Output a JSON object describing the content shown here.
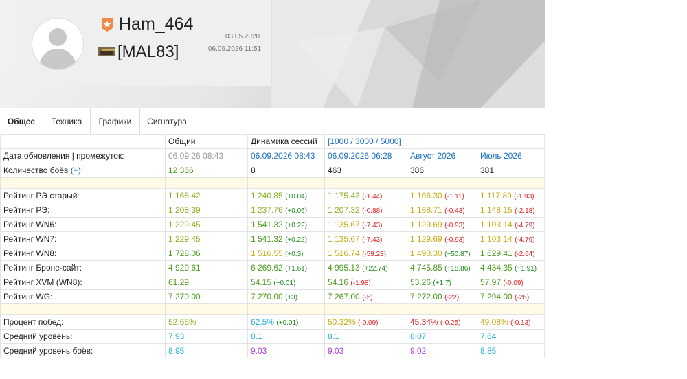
{
  "profile": {
    "nickname": "Ham_464",
    "clan": "[MAL83]",
    "registered": "03.05.2020",
    "updated": "06.09.2026 11:51"
  },
  "tabs": [
    "Общее",
    "Техника",
    "Графики",
    "Сигнатура"
  ],
  "table": {
    "headers": [
      "",
      "Общий",
      "Динамика сессий",
      "[1000 / 3000 / 5000]",
      "",
      ""
    ],
    "dates_row": {
      "label": "Дата обновления | промежуток:",
      "c1": "06.09.26 08:43",
      "c2": "06.09.2026 08:43",
      "c3": "06.09.2026 06:28",
      "c4": "Август 2026",
      "c5": "Июль 2026"
    },
    "battles_row": {
      "label": "Количество боёв",
      "plus": "(+)",
      "c1": "12 366",
      "c2": "8",
      "c3": "463",
      "c4": "386",
      "c5": "381",
      "colon": ":"
    },
    "ratings": [
      {
        "label": "Рейтинг РЭ старый:",
        "c1": "1 168.42",
        "c2": "1 240.85",
        "d2": "(+0.04)",
        "c3": "1 175.43",
        "d3": "(-1.44)",
        "c4": "1 106.30",
        "d4": "(-1.11)",
        "c5": "1 117.89",
        "d5": "(-1.93)"
      },
      {
        "label": "Рейтинг РЭ:",
        "c1": "1 208.39",
        "c2": "1 237.76",
        "d2": "(+0.06)",
        "c3": "1 207.32",
        "d3": "(-0.88)",
        "c4": "1 168.71",
        "d4": "(-0.43)",
        "c5": "1 148.15",
        "d5": "(-2.18)"
      },
      {
        "label": "Рейтинг WN6:",
        "c1": "1 229.45",
        "c2": "1 541.32",
        "d2": "(+0.22)",
        "c3": "1 135.67",
        "d3": "(-7.43)",
        "c4": "1 129.69",
        "d4": "(-0.93)",
        "c5": "1 103.14",
        "d5": "(-4.79)"
      },
      {
        "label": "Рейтинг WN7:",
        "c1": "1 229.45",
        "c2": "1 541.32",
        "d2": "(+0.22)",
        "c3": "1 135.67",
        "d3": "(-7.43)",
        "c4": "1 129.69",
        "d4": "(-0.93)",
        "c5": "1 103.14",
        "d5": "(-4.79)"
      },
      {
        "label": "Рейтинг WN8:",
        "c1": "1 728.06",
        "c2": "1 516.55",
        "d2": "(+0.3)",
        "c3": "1 516.74",
        "d3": "(-59.23)",
        "c4": "1 490.30",
        "d4": "(+50.87)",
        "c5": "1 629.41",
        "d5": "(-2.64)"
      },
      {
        "label": "Рейтинг Броне-сайт:",
        "c1": "4 929.61",
        "c2": "6 269.62",
        "d2": "(+1.61)",
        "c3": "4 995.13",
        "d3": "(+22.74)",
        "c4": "4 745.85",
        "d4": "(+18.86)",
        "c5": "4 434.35",
        "d5": "(+1.91)"
      },
      {
        "label": "Рейтинг XVM (WN8):",
        "c1": "61.29",
        "c2": "54.15",
        "d2": "(+0.01)",
        "c3": "54.16",
        "d3": "(-1.98)",
        "c4": "53.26",
        "d4": "(+1.7)",
        "c5": "57.97",
        "d5": "(-0.09)"
      },
      {
        "label": "Рейтинг WG:",
        "c1": "7 270.00",
        "c2": "7 270.00",
        "d2": "(+3)",
        "c3": "7 267.00",
        "d3": "(-5)",
        "c4": "7 272.00",
        "d4": "(-22)",
        "c5": "7 294.00",
        "d5": "(-26)"
      }
    ],
    "other": [
      {
        "label": "Процент побед:",
        "c1": "52.65%",
        "c2": "62.5%",
        "d2": "(+0.01)",
        "c3": "50.32%",
        "d3": "(-0.09)",
        "c4": "45.34%",
        "d4": "(-0.25)",
        "c5": "49.08%",
        "d5": "(-0.13)"
      },
      {
        "label": "Средний уровень:",
        "c1": "7.93",
        "c2": "8.1",
        "c3": "8.1",
        "c4": "8.07",
        "c5": "7.64"
      },
      {
        "label": "Средний уровень боёв:",
        "c1": "8.95",
        "c2": "9.03",
        "c3": "9.03",
        "c4": "9.02",
        "c5": "8.85"
      }
    ]
  }
}
